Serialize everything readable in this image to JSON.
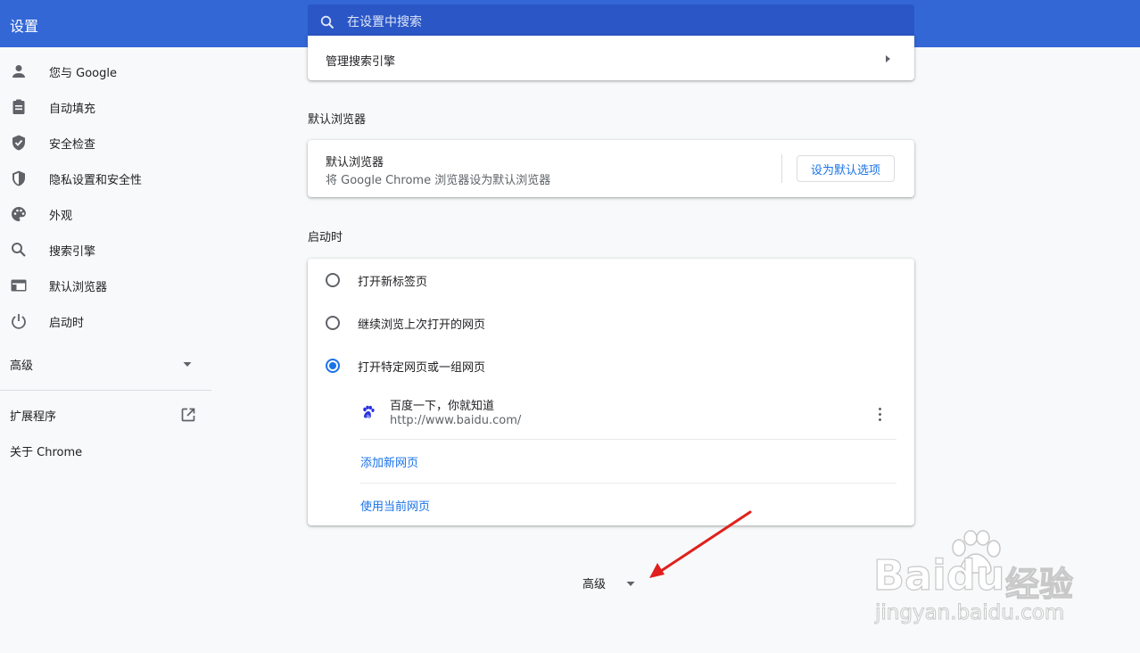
{
  "app": {
    "title": "设置"
  },
  "search": {
    "placeholder": "在设置中搜索"
  },
  "sidebar": {
    "items": [
      {
        "label": "您与 Google",
        "icon": "person-icon"
      },
      {
        "label": "自动填充",
        "icon": "clipboard-icon"
      },
      {
        "label": "安全检查",
        "icon": "shield-check-icon"
      },
      {
        "label": "隐私设置和安全性",
        "icon": "shield-icon"
      },
      {
        "label": "外观",
        "icon": "palette-icon"
      },
      {
        "label": "搜索引擎",
        "icon": "search-icon"
      },
      {
        "label": "默认浏览器",
        "icon": "browser-window-icon"
      },
      {
        "label": "启动时",
        "icon": "power-icon"
      }
    ],
    "advanced_label": "高级",
    "extensions_label": "扩展程序",
    "about_label": "关于 Chrome"
  },
  "search_engine_card": {
    "manage_label": "管理搜索引擎"
  },
  "default_browser": {
    "section_title": "默认浏览器",
    "row_title": "默认浏览器",
    "row_subtitle": "将 Google Chrome 浏览器设为默认浏览器",
    "button_label": "设为默认选项"
  },
  "startup": {
    "section_title": "启动时",
    "options": [
      {
        "label": "打开新标签页",
        "checked": false
      },
      {
        "label": "继续浏览上次打开的网页",
        "checked": false
      },
      {
        "label": "打开特定网页或一组网页",
        "checked": true
      }
    ],
    "page": {
      "title": "百度一下，你就知道",
      "url": "http://www.baidu.com/",
      "icon": "baidu-paw-icon"
    },
    "add_page_label": "添加新网页",
    "use_current_label": "使用当前网页"
  },
  "bottom_advanced": {
    "label": "高级"
  },
  "watermark": {
    "brand": "Baidu",
    "suffix": "经验",
    "url": "jingyan.baidu.com"
  },
  "colors": {
    "header": "#3367d6",
    "search_bg": "#2a56c6",
    "link": "#1a73e8",
    "arrow": "#e0201c"
  }
}
